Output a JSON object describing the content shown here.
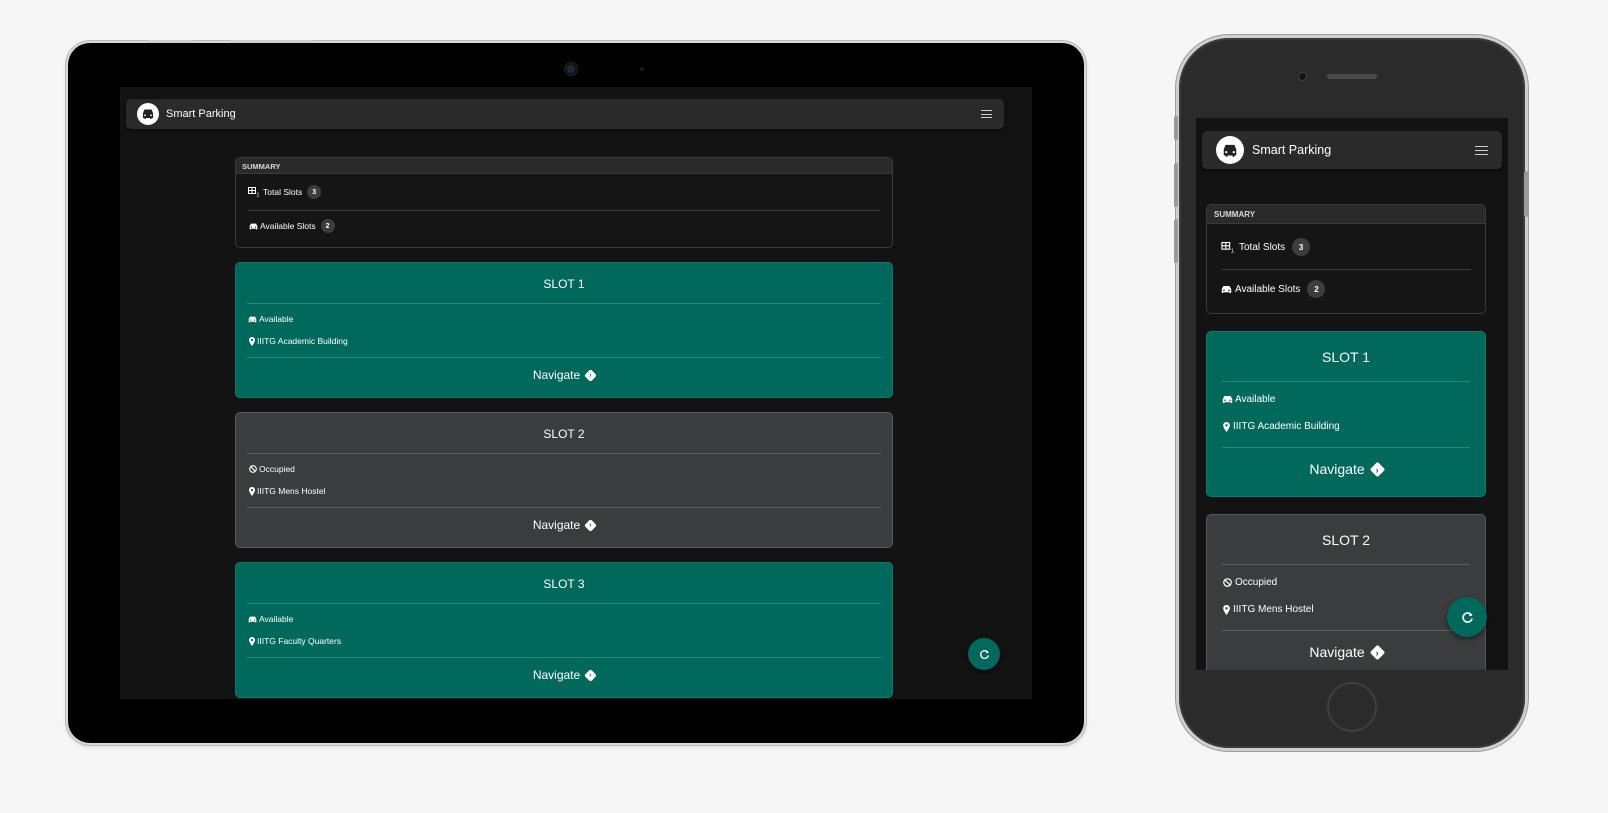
{
  "app": {
    "brand": "Smart Parking",
    "colors": {
      "available": "#00695c",
      "occupied": "#3b3c3e",
      "background": "#131313",
      "navbar": "#2a2a2a"
    }
  },
  "summary": {
    "heading": "SUMMARY",
    "total_label": "Total Slots",
    "total_count": "3",
    "available_label": "Available Slots",
    "available_count": "2",
    "total_icon": "table-sort-icon",
    "available_icon": "car-icon"
  },
  "slots": [
    {
      "title": "SLOT 1",
      "status": "Available",
      "status_icon": "car-icon",
      "location": "IIITG Academic Building",
      "navigate": "Navigate"
    },
    {
      "title": "SLOT 2",
      "status": "Occupied",
      "status_icon": "ban-icon",
      "location": "IIITG Mens Hostel",
      "navigate": "Navigate"
    },
    {
      "title": "SLOT 3",
      "status": "Available",
      "status_icon": "car-icon",
      "location": "IIITG Faculty Quarters",
      "navigate": "Navigate"
    }
  ],
  "refresh_icon": "refresh-icon"
}
